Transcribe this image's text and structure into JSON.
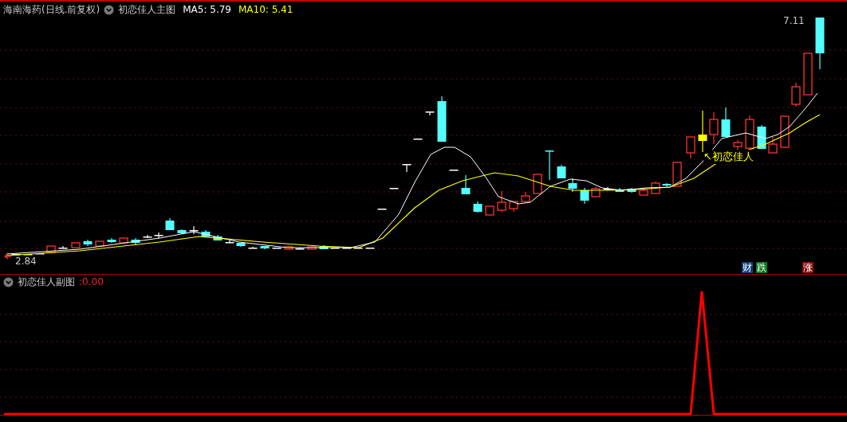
{
  "main_header": {
    "security": "海南海药(日线.前复权)",
    "indicator": "初恋佳人主图",
    "legend": [
      {
        "label": "MA5: 5.79",
        "color": "#ffffff"
      },
      {
        "label": "MA10: 5.41",
        "color": "#ffff00"
      }
    ]
  },
  "main_chart": {
    "high_label": "7.11",
    "low_label": "2.84",
    "annotation": "↖初恋佳人",
    "markers": [
      {
        "text": "财",
        "color": "#0d3f7e"
      },
      {
        "text": "跌",
        "color": "#0b7a1c"
      },
      {
        "text": "涨",
        "color": "#8a0d0d"
      }
    ]
  },
  "sub_header": {
    "indicator": "初恋佳人副图",
    "value": ":0.00"
  }
}
